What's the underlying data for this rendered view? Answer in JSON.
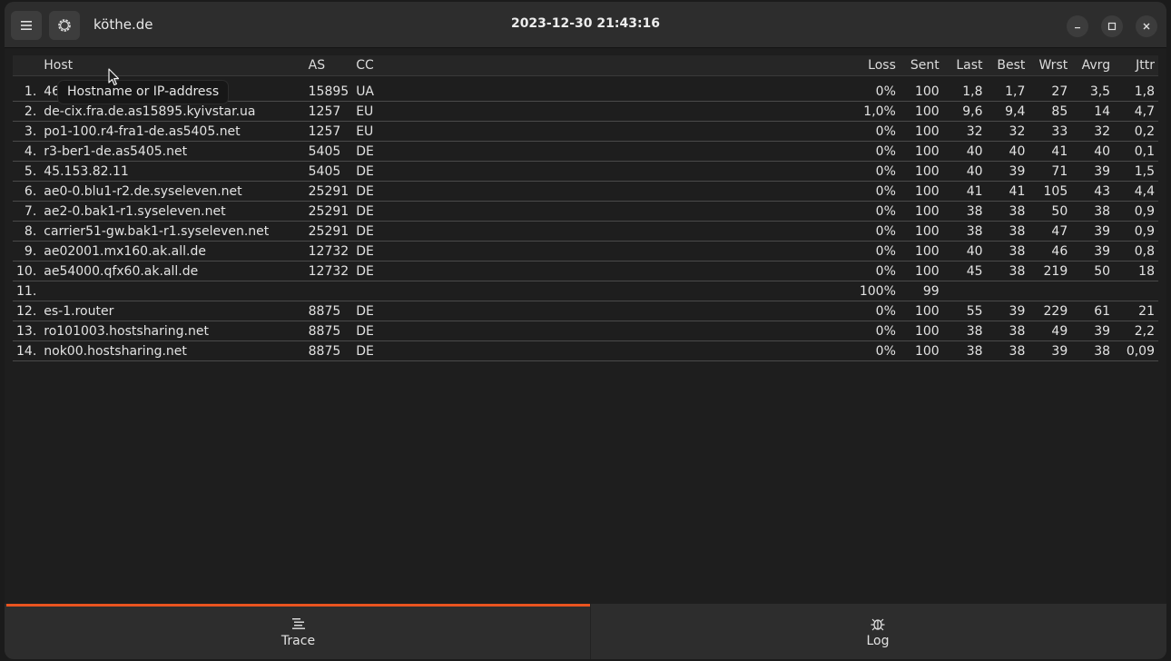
{
  "header": {
    "title": "köthe.de",
    "timestamp": "2023-12-30 21:43:16",
    "menu_icon": "hamburger-menu-icon",
    "settings_icon": "gear-icon"
  },
  "table": {
    "columns": [
      "Host",
      "AS",
      "CC",
      "Loss",
      "Sent",
      "Last",
      "Best",
      "Wrst",
      "Avrg",
      "Jttr"
    ],
    "rows": [
      {
        "n": "1.",
        "host": "46.219.88.85.kyivstar.net",
        "as": "15895",
        "cc": "UA",
        "loss": "0%",
        "sent": "100",
        "last": "1,8",
        "best": "1,7",
        "wrst": "27",
        "avrg": "3,5",
        "jttr": "1,8"
      },
      {
        "n": "2.",
        "host": "de-cix.fra.de.as15895.kyivstar.ua",
        "as": "1257",
        "cc": "EU",
        "loss": "1,0%",
        "sent": "100",
        "last": "9,6",
        "best": "9,4",
        "wrst": "85",
        "avrg": "14",
        "jttr": "4,7"
      },
      {
        "n": "3.",
        "host": "po1-100.r4-fra1-de.as5405.net",
        "as": "1257",
        "cc": "EU",
        "loss": "0%",
        "sent": "100",
        "last": "32",
        "best": "32",
        "wrst": "33",
        "avrg": "32",
        "jttr": "0,2"
      },
      {
        "n": "4.",
        "host": "r3-ber1-de.as5405.net",
        "as": "5405",
        "cc": "DE",
        "loss": "0%",
        "sent": "100",
        "last": "40",
        "best": "40",
        "wrst": "41",
        "avrg": "40",
        "jttr": "0,1"
      },
      {
        "n": "5.",
        "host": "45.153.82.11",
        "as": "5405",
        "cc": "DE",
        "loss": "0%",
        "sent": "100",
        "last": "40",
        "best": "39",
        "wrst": "71",
        "avrg": "39",
        "jttr": "1,5"
      },
      {
        "n": "6.",
        "host": "ae0-0.blu1-r2.de.syseleven.net",
        "as": "25291",
        "cc": "DE",
        "loss": "0%",
        "sent": "100",
        "last": "41",
        "best": "41",
        "wrst": "105",
        "avrg": "43",
        "jttr": "4,4"
      },
      {
        "n": "7.",
        "host": "ae2-0.bak1-r1.syseleven.net",
        "as": "25291",
        "cc": "DE",
        "loss": "0%",
        "sent": "100",
        "last": "38",
        "best": "38",
        "wrst": "50",
        "avrg": "38",
        "jttr": "0,9"
      },
      {
        "n": "8.",
        "host": "carrier51-gw.bak1-r1.syseleven.net",
        "as": "25291",
        "cc": "DE",
        "loss": "0%",
        "sent": "100",
        "last": "38",
        "best": "38",
        "wrst": "47",
        "avrg": "39",
        "jttr": "0,9"
      },
      {
        "n": "9.",
        "host": "ae02001.mx160.ak.all.de",
        "as": "12732",
        "cc": "DE",
        "loss": "0%",
        "sent": "100",
        "last": "40",
        "best": "38",
        "wrst": "46",
        "avrg": "39",
        "jttr": "0,8"
      },
      {
        "n": "10.",
        "host": "ae54000.qfx60.ak.all.de",
        "as": "12732",
        "cc": "DE",
        "loss": "0%",
        "sent": "100",
        "last": "45",
        "best": "38",
        "wrst": "219",
        "avrg": "50",
        "jttr": "18"
      },
      {
        "n": "11.",
        "host": "",
        "as": "",
        "cc": "",
        "loss": "100%",
        "sent": "99",
        "last": "",
        "best": "",
        "wrst": "",
        "avrg": "",
        "jttr": ""
      },
      {
        "n": "12.",
        "host": "es-1.router",
        "as": "8875",
        "cc": "DE",
        "loss": "0%",
        "sent": "100",
        "last": "55",
        "best": "39",
        "wrst": "229",
        "avrg": "61",
        "jttr": "21"
      },
      {
        "n": "13.",
        "host": "ro101003.hostsharing.net",
        "as": "8875",
        "cc": "DE",
        "loss": "0%",
        "sent": "100",
        "last": "38",
        "best": "38",
        "wrst": "49",
        "avrg": "39",
        "jttr": "2,2"
      },
      {
        "n": "14.",
        "host": "nok00.hostsharing.net",
        "as": "8875",
        "cc": "DE",
        "loss": "0%",
        "sent": "100",
        "last": "38",
        "best": "38",
        "wrst": "39",
        "avrg": "38",
        "jttr": "0,09"
      }
    ]
  },
  "tooltip": "Hostname or IP-address",
  "tabs": [
    {
      "label": "Trace",
      "icon": "trace-list-icon",
      "active": true
    },
    {
      "label": "Log",
      "icon": "log-bug-icon",
      "active": false
    }
  ],
  "colors": {
    "accent": "#e95420",
    "background": "#1e1e1e",
    "headerbar": "#2d2d2d"
  }
}
